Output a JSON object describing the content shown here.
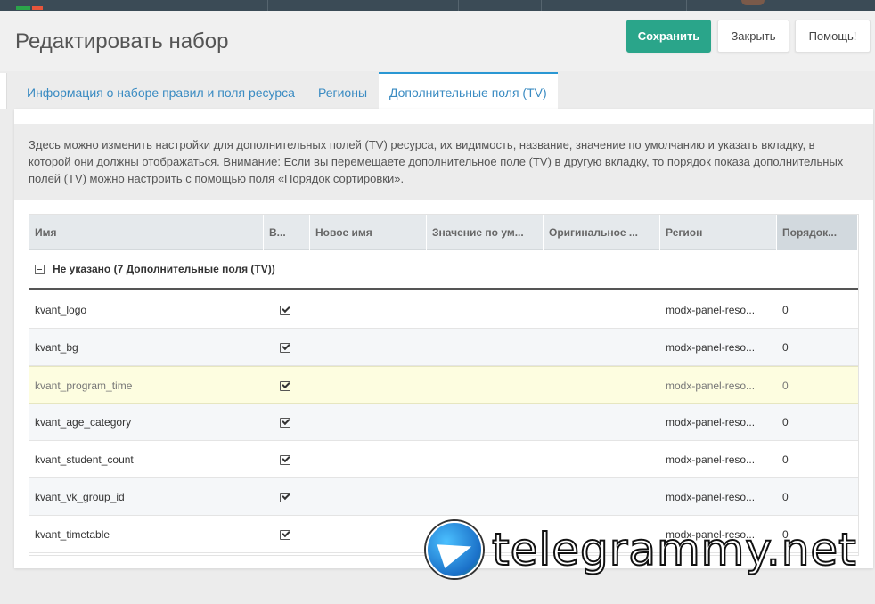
{
  "header": {
    "title": "Редактировать набор",
    "buttons": {
      "save": "Сохранить",
      "close": "Закрыть",
      "help": "Помощь!"
    }
  },
  "tabs": [
    {
      "label": "Информация о наборе правил и поля ресурса"
    },
    {
      "label": "Регионы"
    },
    {
      "label": "Дополнительные поля (TV)",
      "active": true
    }
  ],
  "description": "Здесь можно изменить настройки для дополнительных полей (TV) ресурса, их видимость, название, значение по умолчанию и указать вкладку, в которой они должны отображаться. Внимание: Если вы перемещаете дополнительное поле (TV) в другую вкладку, то порядок показа дополнительных полей (TV) можно настроить с помощью поля «Порядок сортировки».",
  "grid": {
    "columns": [
      "Имя",
      "В...",
      "Новое имя",
      "Значение по ум...",
      "Оригинальное ...",
      "Регион",
      "Порядок..."
    ],
    "group_label": "Не указано (7 Дополнительные поля (TV))",
    "rows": [
      {
        "name": "kvant_logo",
        "visible": true,
        "region": "modx-panel-reso...",
        "order": "0"
      },
      {
        "name": "kvant_bg",
        "visible": true,
        "region": "modx-panel-reso...",
        "order": "0"
      },
      {
        "name": "kvant_program_time",
        "visible": true,
        "region": "modx-panel-reso...",
        "order": "0"
      },
      {
        "name": "kvant_age_category",
        "visible": true,
        "region": "modx-panel-reso...",
        "order": "0"
      },
      {
        "name": "kvant_student_count",
        "visible": true,
        "region": "modx-panel-reso...",
        "order": "0"
      },
      {
        "name": "kvant_vk_group_id",
        "visible": true,
        "region": "modx-panel-reso...",
        "order": "0"
      },
      {
        "name": "kvant_timetable",
        "visible": true,
        "region": "modx-panel-reso...",
        "order": "0"
      }
    ]
  },
  "watermark": {
    "text": "telegrammy.net"
  },
  "colors": {
    "primary": "#2aa58a",
    "tab_active_border": "#2a97d3",
    "link": "#3a8bc2"
  }
}
